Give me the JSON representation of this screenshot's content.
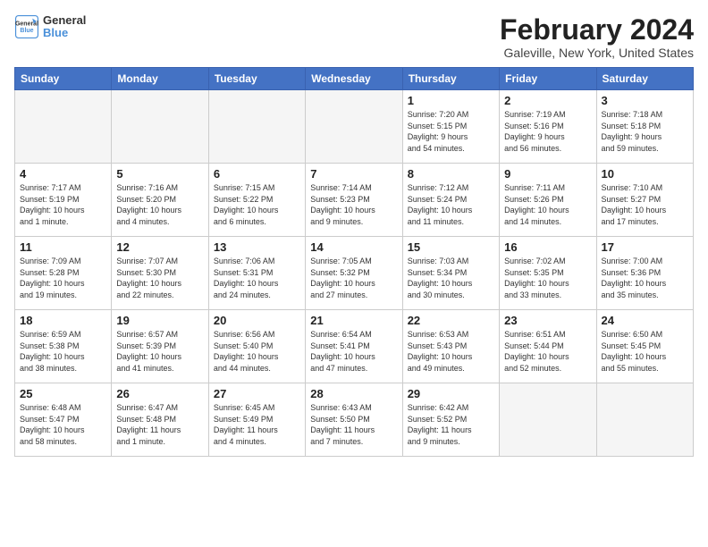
{
  "logo": {
    "line1": "General",
    "line2": "Blue"
  },
  "title": "February 2024",
  "subtitle": "Galeville, New York, United States",
  "headers": [
    "Sunday",
    "Monday",
    "Tuesday",
    "Wednesday",
    "Thursday",
    "Friday",
    "Saturday"
  ],
  "weeks": [
    [
      {
        "day": "",
        "info": ""
      },
      {
        "day": "",
        "info": ""
      },
      {
        "day": "",
        "info": ""
      },
      {
        "day": "",
        "info": ""
      },
      {
        "day": "1",
        "info": "Sunrise: 7:20 AM\nSunset: 5:15 PM\nDaylight: 9 hours\nand 54 minutes."
      },
      {
        "day": "2",
        "info": "Sunrise: 7:19 AM\nSunset: 5:16 PM\nDaylight: 9 hours\nand 56 minutes."
      },
      {
        "day": "3",
        "info": "Sunrise: 7:18 AM\nSunset: 5:18 PM\nDaylight: 9 hours\nand 59 minutes."
      }
    ],
    [
      {
        "day": "4",
        "info": "Sunrise: 7:17 AM\nSunset: 5:19 PM\nDaylight: 10 hours\nand 1 minute."
      },
      {
        "day": "5",
        "info": "Sunrise: 7:16 AM\nSunset: 5:20 PM\nDaylight: 10 hours\nand 4 minutes."
      },
      {
        "day": "6",
        "info": "Sunrise: 7:15 AM\nSunset: 5:22 PM\nDaylight: 10 hours\nand 6 minutes."
      },
      {
        "day": "7",
        "info": "Sunrise: 7:14 AM\nSunset: 5:23 PM\nDaylight: 10 hours\nand 9 minutes."
      },
      {
        "day": "8",
        "info": "Sunrise: 7:12 AM\nSunset: 5:24 PM\nDaylight: 10 hours\nand 11 minutes."
      },
      {
        "day": "9",
        "info": "Sunrise: 7:11 AM\nSunset: 5:26 PM\nDaylight: 10 hours\nand 14 minutes."
      },
      {
        "day": "10",
        "info": "Sunrise: 7:10 AM\nSunset: 5:27 PM\nDaylight: 10 hours\nand 17 minutes."
      }
    ],
    [
      {
        "day": "11",
        "info": "Sunrise: 7:09 AM\nSunset: 5:28 PM\nDaylight: 10 hours\nand 19 minutes."
      },
      {
        "day": "12",
        "info": "Sunrise: 7:07 AM\nSunset: 5:30 PM\nDaylight: 10 hours\nand 22 minutes."
      },
      {
        "day": "13",
        "info": "Sunrise: 7:06 AM\nSunset: 5:31 PM\nDaylight: 10 hours\nand 24 minutes."
      },
      {
        "day": "14",
        "info": "Sunrise: 7:05 AM\nSunset: 5:32 PM\nDaylight: 10 hours\nand 27 minutes."
      },
      {
        "day": "15",
        "info": "Sunrise: 7:03 AM\nSunset: 5:34 PM\nDaylight: 10 hours\nand 30 minutes."
      },
      {
        "day": "16",
        "info": "Sunrise: 7:02 AM\nSunset: 5:35 PM\nDaylight: 10 hours\nand 33 minutes."
      },
      {
        "day": "17",
        "info": "Sunrise: 7:00 AM\nSunset: 5:36 PM\nDaylight: 10 hours\nand 35 minutes."
      }
    ],
    [
      {
        "day": "18",
        "info": "Sunrise: 6:59 AM\nSunset: 5:38 PM\nDaylight: 10 hours\nand 38 minutes."
      },
      {
        "day": "19",
        "info": "Sunrise: 6:57 AM\nSunset: 5:39 PM\nDaylight: 10 hours\nand 41 minutes."
      },
      {
        "day": "20",
        "info": "Sunrise: 6:56 AM\nSunset: 5:40 PM\nDaylight: 10 hours\nand 44 minutes."
      },
      {
        "day": "21",
        "info": "Sunrise: 6:54 AM\nSunset: 5:41 PM\nDaylight: 10 hours\nand 47 minutes."
      },
      {
        "day": "22",
        "info": "Sunrise: 6:53 AM\nSunset: 5:43 PM\nDaylight: 10 hours\nand 49 minutes."
      },
      {
        "day": "23",
        "info": "Sunrise: 6:51 AM\nSunset: 5:44 PM\nDaylight: 10 hours\nand 52 minutes."
      },
      {
        "day": "24",
        "info": "Sunrise: 6:50 AM\nSunset: 5:45 PM\nDaylight: 10 hours\nand 55 minutes."
      }
    ],
    [
      {
        "day": "25",
        "info": "Sunrise: 6:48 AM\nSunset: 5:47 PM\nDaylight: 10 hours\nand 58 minutes."
      },
      {
        "day": "26",
        "info": "Sunrise: 6:47 AM\nSunset: 5:48 PM\nDaylight: 11 hours\nand 1 minute."
      },
      {
        "day": "27",
        "info": "Sunrise: 6:45 AM\nSunset: 5:49 PM\nDaylight: 11 hours\nand 4 minutes."
      },
      {
        "day": "28",
        "info": "Sunrise: 6:43 AM\nSunset: 5:50 PM\nDaylight: 11 hours\nand 7 minutes."
      },
      {
        "day": "29",
        "info": "Sunrise: 6:42 AM\nSunset: 5:52 PM\nDaylight: 11 hours\nand 9 minutes."
      },
      {
        "day": "",
        "info": ""
      },
      {
        "day": "",
        "info": ""
      }
    ]
  ]
}
